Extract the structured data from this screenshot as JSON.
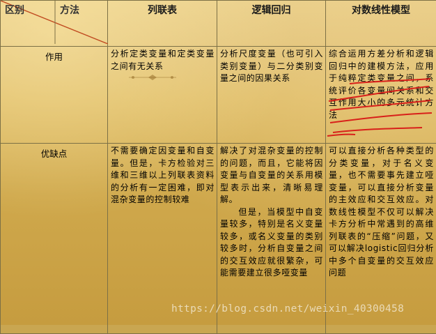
{
  "header": {
    "corner_left": "区别",
    "corner_right": "方法",
    "col1": "列联表",
    "col2": "逻辑回归",
    "col3": "对数线性模型"
  },
  "rows": [
    {
      "label": "作用",
      "col1": "分析定类变量和定类变量之间有无关系",
      "col2": "分析尺度变量（也可引入类别变量）与二分类别变量之间的因果关系",
      "col3": "综合运用方差分析和逻辑回归中的建模方法，应用于纯粹定类变量之间，系统评价各变量间关系和交互作用大小的多元统计方法"
    },
    {
      "label": "优缺点",
      "col1": "不需要确定因变量和自变量。但是，卡方检验对三维和三维以上列联表资料的分析有一定困难，即对混杂变量的控制较难",
      "col2_p1": "解决了对混杂变量的控制的问题，而且，它能将因变量与自变量的关系用模型表示出来，清晰易理解。",
      "col2_p2": "但是，当模型中自变量较多，特别是名义变量较多，或名义变量的类别较多时，分析自变量之间的交互效应就很繁杂，可能需要建立很多哑变量",
      "col3": "可以直接分析各种类型的分类变量，对于名义变量，也不需要事先建立哑变量，可以直接分析变量的主效应和交互效应。对数线性模型不仅可以解决卡方分析中常遇到的高维列联表的“压缩”问题，又可以解决logistic回归分析中多个自变量的交互效应问题"
    }
  ],
  "watermark": "https://blog.csdn.net/weixin_40300458"
}
